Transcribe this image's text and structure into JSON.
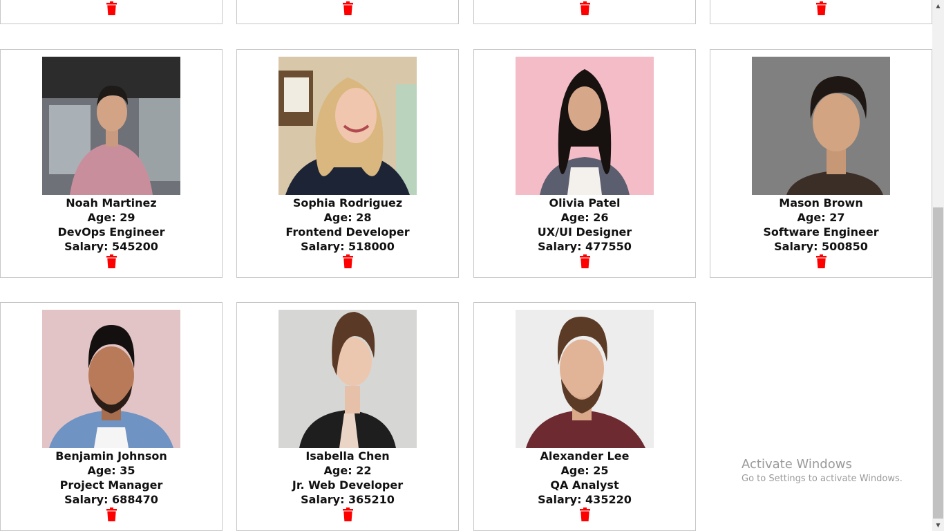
{
  "employees": [
    {
      "name": "Noah Martinez",
      "age": "Age: 29",
      "role": "DevOps Engineer",
      "salary": "Salary: 545200"
    },
    {
      "name": "Sophia Rodriguez",
      "age": "Age: 28",
      "role": "Frontend Developer",
      "salary": "Salary: 518000"
    },
    {
      "name": "Olivia Patel",
      "age": "Age: 26",
      "role": "UX/UI Designer",
      "salary": "Salary: 477550"
    },
    {
      "name": "Mason Brown",
      "age": "Age: 27",
      "role": "Software Engineer",
      "salary": "Salary: 500850"
    },
    {
      "name": "Benjamin Johnson",
      "age": "Age: 35",
      "role": "Project Manager",
      "salary": "Salary: 688470"
    },
    {
      "name": "Isabella Chen",
      "age": "Age: 22",
      "role": "Jr. Web Developer",
      "salary": "Salary: 365210"
    },
    {
      "name": "Alexander Lee",
      "age": "Age: 25",
      "role": "QA Analyst",
      "salary": "Salary: 435220"
    }
  ],
  "icons": {
    "delete": "trash-icon"
  },
  "colors": {
    "delete": "#ff0000",
    "card_border": "#c6c6c6"
  },
  "watermark": {
    "title": "Activate Windows",
    "subtitle": "Go to Settings to activate Windows."
  }
}
